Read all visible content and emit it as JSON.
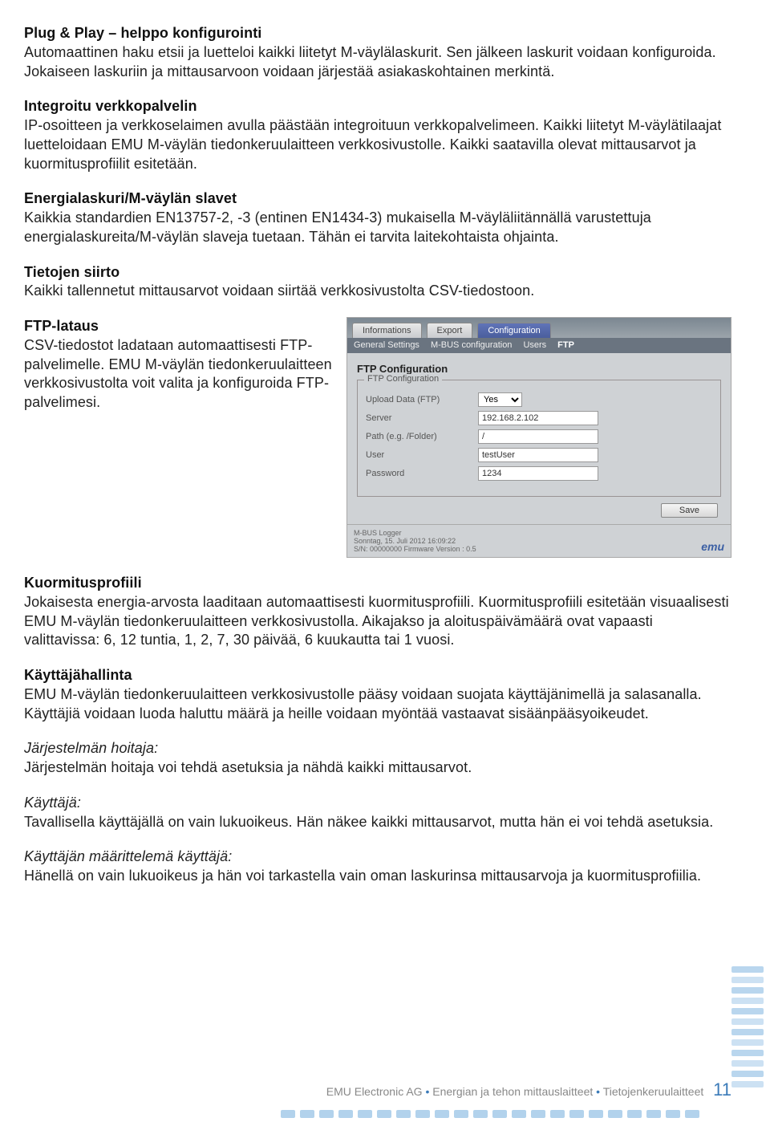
{
  "sections": {
    "s1": {
      "h": "Plug & Play – helppo konfigurointi",
      "p": "Automaattinen haku etsii ja luetteloi kaikki liitetyt M-väylälaskurit. Sen jälkeen laskurit voidaan konfiguroida. Jokaiseen laskuriin ja mittausarvoon voidaan järjestää asiakaskohtainen merkintä."
    },
    "s2": {
      "h": "Integroitu verkkopalvelin",
      "p": "IP-osoitteen ja verkkoselaimen avulla päästään integroituun verkkopalvelimeen. Kaikki liitetyt M-väylätilaajat luetteloidaan EMU M-väylän tiedonkeruulaitteen verkkosivustolle. Kaikki saatavilla olevat mittausarvot ja kuormitusprofiilit esitetään."
    },
    "s3": {
      "h": "Energialaskuri/M-väylän slavet",
      "p": "Kaikkia standardien EN13757-2, -3 (entinen EN1434-3) mukaisella M-väyläliitännällä varustettuja energialaskureita/M-väylän slaveja tuetaan. Tähän ei tarvita laitekohtaista ohjainta."
    },
    "s4": {
      "h": "Tietojen siirto",
      "p": "Kaikki tallennetut mittausarvot voidaan siirtää verkkosivustolta CSV-tiedostoon."
    },
    "s5": {
      "h": "FTP-lataus",
      "p": "CSV-tiedostot ladataan automaattisesti FTP-palvelimelle. EMU M-väylän tiedonkeruulaitteen verkkosivustolta voit valita ja konfiguroida FTP-palvelimesi."
    },
    "s6": {
      "h": "Kuormitusprofiili",
      "p": "Jokaisesta energia-arvosta laaditaan automaattisesti kuormitusprofiili. Kuormitusprofiili esitetään visuaalisesti EMU M-väylän tiedonkeruulaitteen verkkosivustolla. Aikajakso ja aloituspäivämäärä ovat vapaasti valittavissa: 6, 12 tuntia, 1, 2, 7, 30 päivää, 6 kuukautta tai 1 vuosi."
    },
    "s7": {
      "h": "Käyttäjähallinta",
      "p1": "EMU M-väylän tiedonkeruulaitteen verkkosivustolle pääsy voidaan suojata käyttäjänimellä ja salasanalla.",
      "p2": "Käyttäjiä voidaan luoda haluttu määrä ja heille voidaan myöntää vastaavat sisäänpääsyoikeudet.",
      "r1h": "Järjestelmän hoitaja:",
      "r1p": "Järjestelmän hoitaja voi tehdä asetuksia ja nähdä kaikki mittausarvot.",
      "r2h": "Käyttäjä:",
      "r2p": "Tavallisella käyttäjällä on vain lukuoikeus. Hän näkee kaikki mittausarvot, mutta hän ei voi tehdä asetuksia.",
      "r3h": "Käyttäjän määrittelemä käyttäjä:",
      "r3p": "Hänellä on vain lukuoikeus ja hän voi tarkastella vain oman laskurinsa mittausarvoja ja kuormitusprofiilia."
    }
  },
  "ftp_panel": {
    "tabs1": [
      "Informations",
      "Export",
      "Configuration"
    ],
    "tabs2": [
      "General Settings",
      "M-BUS configuration",
      "Users",
      "FTP"
    ],
    "heading": "FTP Configuration",
    "legend": "FTP Configuration",
    "labels": {
      "upload": "Upload Data (FTP)",
      "server": "Server",
      "path": "Path (e.g. /Folder)",
      "user": "User",
      "password": "Password"
    },
    "values": {
      "upload": "Yes",
      "server": "192.168.2.102",
      "path": "/",
      "user": "testUser",
      "password": "1234"
    },
    "save": "Save",
    "footer1": "M-BUS Logger",
    "footer2": "Sonntag, 15. Juli 2012 16:09:22",
    "footer3": "S/N: 00000000 Firmware Version : 0.5",
    "logo": "emu"
  },
  "footer": {
    "company": "EMU Electronic AG",
    "sep": " • ",
    "t1": "Energian ja tehon mittauslaitteet",
    "t2": "Tietojenkeruulaitteet",
    "page": "11"
  }
}
